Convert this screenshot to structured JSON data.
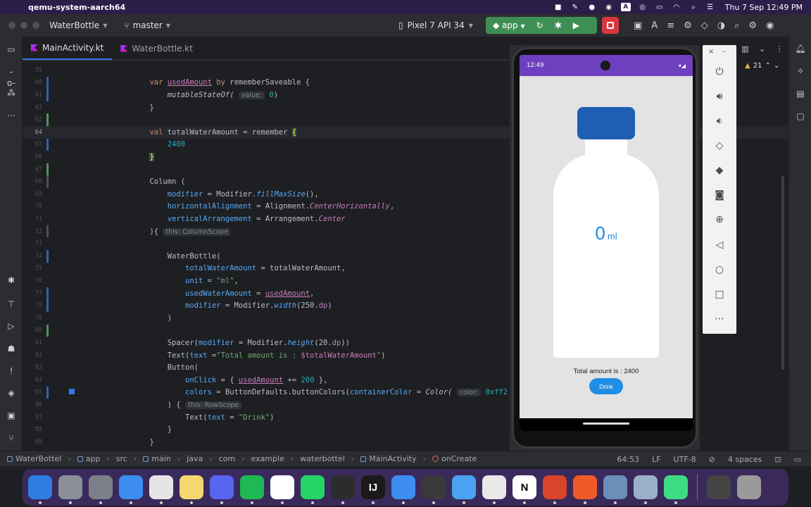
{
  "menubar": {
    "apple_glyph": "",
    "app_name": "qemu-system-aarch64",
    "status_icons": [
      "app-icon",
      "feather-icon",
      "messenger-icon",
      "record-icon",
      "a-input-icon",
      "person-icon",
      "battery-icon",
      "wifi-icon",
      "search-icon",
      "control-center-icon"
    ],
    "input_letter": "A",
    "clock": "Thu 7 Sep  12:49 PM"
  },
  "titlebar": {
    "project": "WaterBottle",
    "branch": "master",
    "device": "Pixel 7 API 34",
    "run_config": "app"
  },
  "tabs": [
    {
      "label": "MainActivity.kt",
      "active": true
    },
    {
      "label": "WaterBottle.kt",
      "active": false
    }
  ],
  "editor": {
    "hints": {
      "value": "value:",
      "column_scope": "this: ColumnScope",
      "row_scope": "this: RowScope",
      "color": "color:"
    },
    "lines": {
      "l59": "59",
      "l60": "60",
      "l61": "61",
      "l62": "62",
      "l63": "63",
      "l64": "64",
      "l65": "65",
      "l66": "66",
      "l67": "67",
      "l68": "68",
      "l69": "69",
      "l70": "70",
      "l71": "71",
      "l72": "72",
      "l73": "73",
      "l74": "74",
      "l75": "75",
      "l76": "76",
      "l77": "77",
      "l78": "78",
      "l79": "79",
      "l80": "80",
      "l81": "81",
      "l82": "82",
      "l83": "83",
      "l84": "84",
      "l85": "85",
      "l86": "86",
      "l87": "87",
      "l88": "88",
      "l89": "89"
    },
    "code": {
      "var_kw": "var",
      "used_amount": "usedAmount",
      "by_kw": "by",
      "remember_saveable": "rememberSaveable",
      "open_brace": "{",
      "close_brace": "}",
      "mutable_state_of": "mutableStateOf(",
      "zero": "0",
      "close_paren": ")",
      "val_kw": "val",
      "total_water_amount": "totalWaterAmount",
      "eq": "=",
      "remember": "remember",
      "num_2400": "2400",
      "column_open": "Column (",
      "modifier_param": "modifier",
      "modifier_obj": "Modifier.",
      "fill_max_size": "fillMaxSize",
      "paren_comma": "(),",
      "horizontal_alignment": "horizontalAlignment",
      "alignment": "Alignment.",
      "center_horizontally": "CenterHorizontally",
      "comma": ",",
      "vertical_arrangement": "verticalArrangement",
      "arrangement": "Arrangement.",
      "center": "Center",
      "paren_brace": "){",
      "water_bottle_open": "WaterBottle(",
      "total_water_amount_param": "totalWaterAmount",
      "unit_param": "unit",
      "ml_str": "\"ml\"",
      "used_water_amount_param": "usedWaterAmount",
      "modifier_width": "Modifier.",
      "width_fn": "width",
      "width_val": "(250.",
      "dp": "dp",
      "paren_close": ")",
      "spacer_open": "Spacer(",
      "height_fn": "height",
      "height_val": "(20.",
      "double_close": "))",
      "text_open": "Text(",
      "text_param": "text",
      "total_amount_str": "\"Total amount is : ",
      "template_var": "$totalWaterAmount",
      "quote": "\"",
      "button_open": "Button(",
      "on_click": "onClick",
      "brace_space": "{ ",
      "plus_eq": "+=",
      "num_200": "200",
      "brace_comma": " },",
      "colors_param": "colors",
      "button_defaults": "ButtonDefaults.buttonColors(",
      "container_color": "containerColor",
      "color_fn": "Color(",
      "hex_val": "0xff2",
      "paren_space_brace": ") {",
      "drink_str": "\"Drink\""
    }
  },
  "emulator": {
    "time": "12:49",
    "status_icons": "▾◢",
    "amount_value": "0",
    "amount_unit": "ml",
    "total_text": "Total amount is : 2400",
    "button_label": "Drink",
    "panel_close": "×",
    "panel_min": "–"
  },
  "right": {
    "warning_count": "21"
  },
  "statusbar": {
    "crumbs": [
      "WaterBottel",
      "app",
      "src",
      "main",
      "java",
      "com",
      "example",
      "waterbottel",
      "MainActivity",
      "onCreate"
    ],
    "position": "64:53",
    "line_ending": "LF",
    "encoding": "UTF-8",
    "indent": "4 spaces"
  },
  "dock": {
    "apps": [
      {
        "name": "finder",
        "color": "#2f7de1",
        "glyph": ""
      },
      {
        "name": "launchpad",
        "color": "#8a8f98",
        "glyph": ""
      },
      {
        "name": "system-settings",
        "color": "#7a7f88",
        "glyph": ""
      },
      {
        "name": "mail",
        "color": "#3b8ef0",
        "glyph": ""
      },
      {
        "name": "chrome",
        "color": "#e5e5e5",
        "glyph": ""
      },
      {
        "name": "notes",
        "color": "#f5d76e",
        "glyph": ""
      },
      {
        "name": "discord",
        "color": "#5865f2",
        "glyph": ""
      },
      {
        "name": "spotify",
        "color": "#1db954",
        "glyph": ""
      },
      {
        "name": "capcut",
        "color": "#ffffff",
        "glyph": ""
      },
      {
        "name": "whatsapp",
        "color": "#25d366",
        "glyph": ""
      },
      {
        "name": "figma",
        "color": "#2c2c2c",
        "glyph": ""
      },
      {
        "name": "intellij",
        "color": "#1a1a1a",
        "glyph": "IJ"
      },
      {
        "name": "xcode-instruments",
        "color": "#3d8cf0",
        "glyph": ""
      },
      {
        "name": "android-studio-alt",
        "color": "#3a3a3a",
        "glyph": ""
      },
      {
        "name": "xcode",
        "color": "#4aa3f0",
        "glyph": ""
      },
      {
        "name": "textedit",
        "color": "#e9e9e9",
        "glyph": ""
      },
      {
        "name": "notion",
        "color": "#ffffff",
        "glyph": "N"
      },
      {
        "name": "garageband",
        "color": "#d7452b",
        "glyph": ""
      },
      {
        "name": "pencil",
        "color": "#f05a28",
        "glyph": ""
      },
      {
        "name": "disk-utility",
        "color": "#6b8fb8",
        "glyph": ""
      },
      {
        "name": "preview",
        "color": "#9ab0c8",
        "glyph": ""
      },
      {
        "name": "android-studio",
        "color": "#3ddc84",
        "glyph": ""
      },
      {
        "name": "recent-window",
        "color": "#444444",
        "glyph": ""
      },
      {
        "name": "trash",
        "color": "#9a9a9a",
        "glyph": ""
      }
    ]
  }
}
